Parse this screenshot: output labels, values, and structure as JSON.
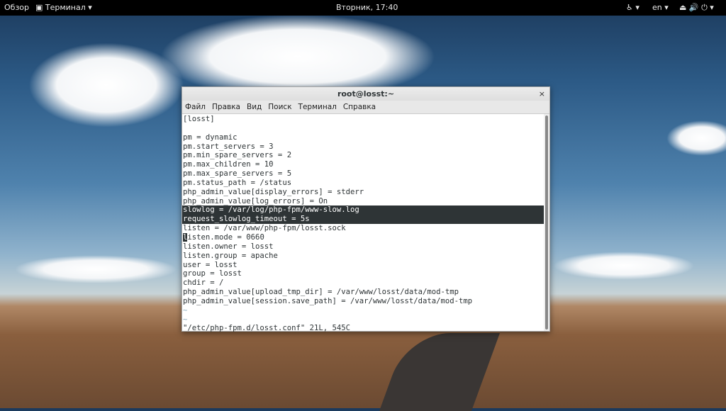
{
  "topbar": {
    "overview": "Обзор",
    "app": "Терминал ▾",
    "clock": "Вторник, 17:40",
    "accessibility": "♿ ▾",
    "lang": "en ▾",
    "status_icons": "⏏ 🔊 ⏻ ▾"
  },
  "window": {
    "title": "root@losst:~",
    "close": "×",
    "menu": [
      "Файл",
      "Правка",
      "Вид",
      "Поиск",
      "Терминал",
      "Справка"
    ]
  },
  "terminal": {
    "lines": [
      "[losst]",
      "",
      "pm = dynamic",
      "pm.start_servers = 3",
      "pm.min_spare_servers = 2",
      "pm.max_children = 10",
      "pm.max_spare_servers = 5",
      "pm.status_path = /status",
      "php_admin_value[display_errors] = stderr",
      "php_admin_value[log_errors] = On",
      "slowlog = /var/log/php-fpm/www-slow.log",
      "request_slowlog_timeout = 5s",
      "listen = /var/www/php-fpm/losst.sock",
      "listen.mode = 0660",
      "listen.owner = losst",
      "listen.group = apache",
      "user = losst",
      "group = losst",
      "chdir = /",
      "php_admin_value[upload_tmp_dir] = /var/www/losst/data/mod-tmp",
      "php_admin_value[session.save_path] = /var/www/losst/data/mod-tmp",
      "~",
      "~",
      "\"/etc/php-fpm.d/losst.conf\" 21L, 545C"
    ],
    "highlighted_lines": [
      10,
      11
    ],
    "cursor_line": 13
  }
}
